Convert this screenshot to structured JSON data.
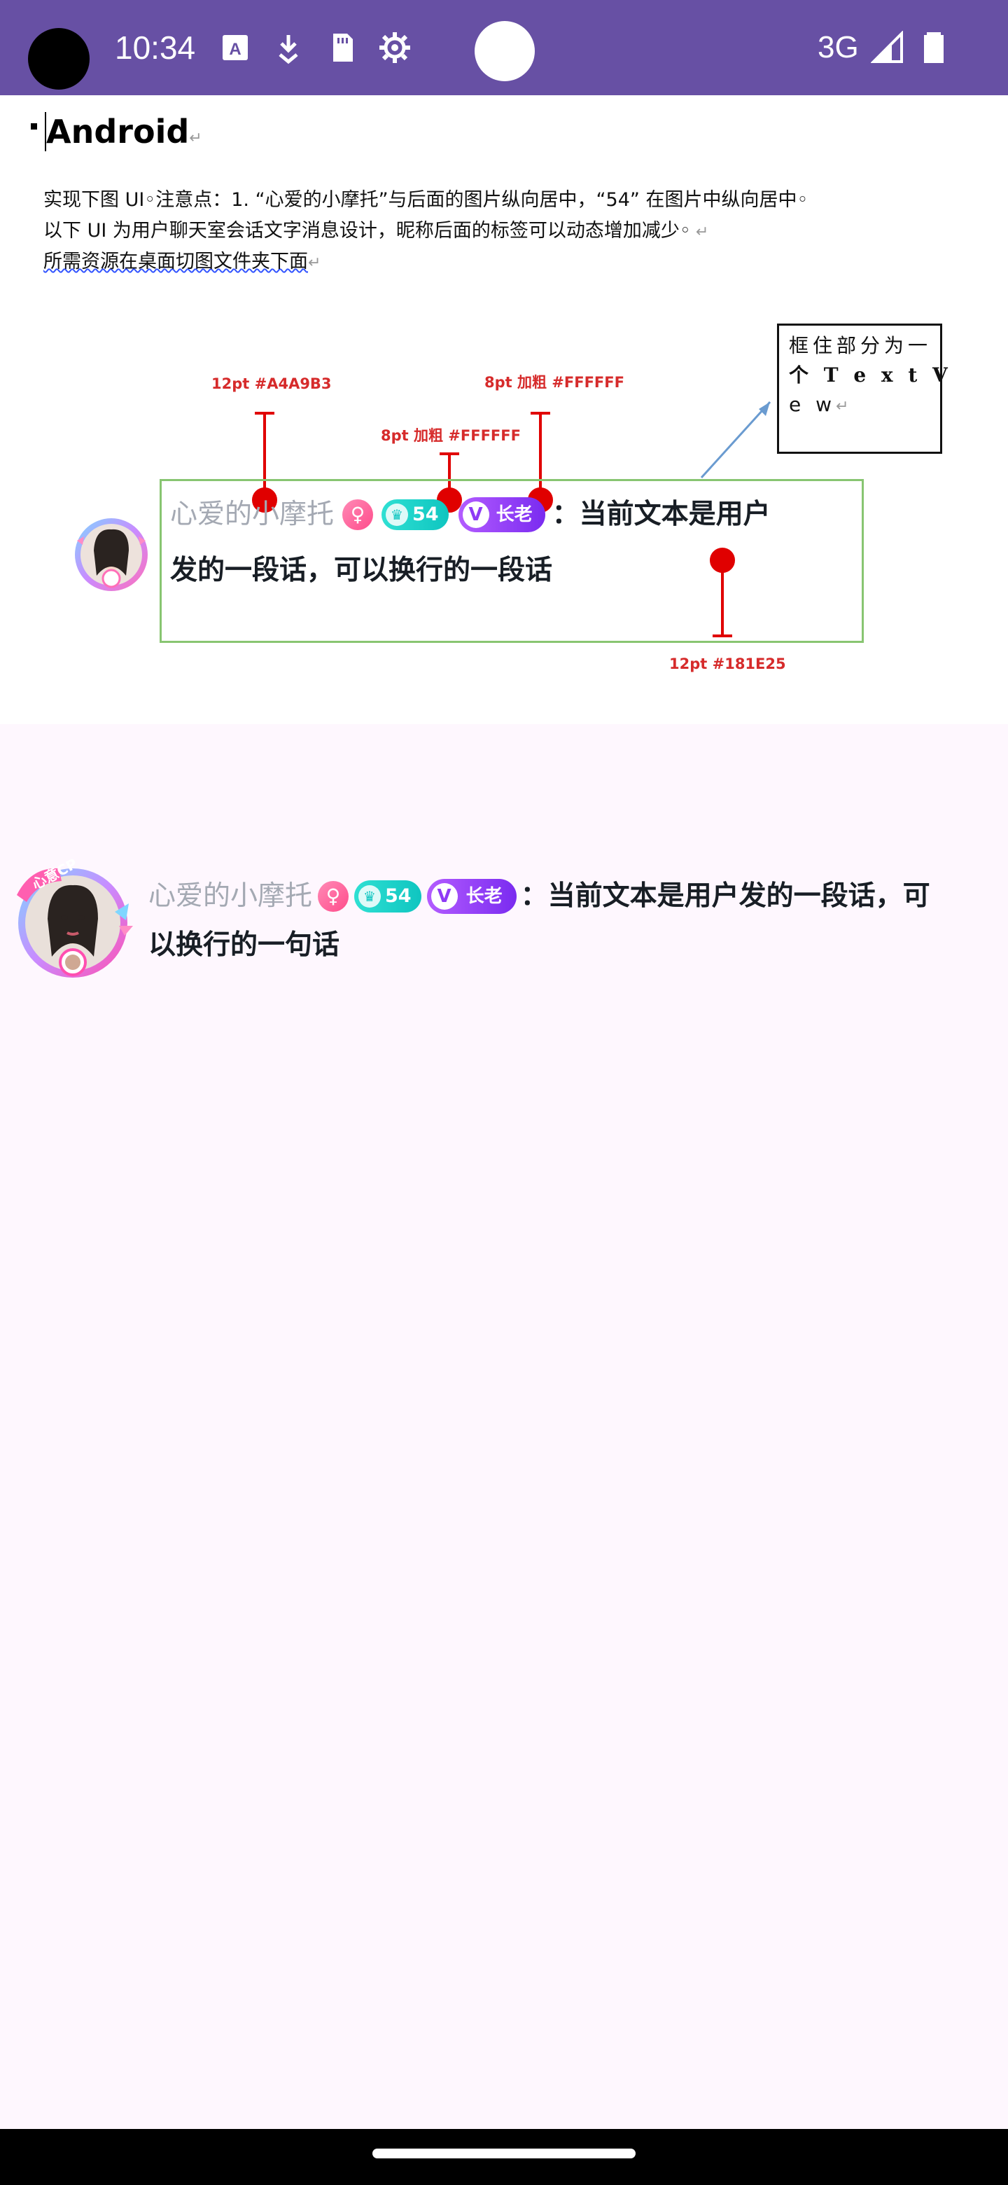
{
  "status_bar": {
    "time": "10:34",
    "network": "3G",
    "icons": [
      "font-a-icon",
      "download-icon",
      "sd-card-icon",
      "settings-gear-icon",
      "signal-icon",
      "battery-icon"
    ],
    "background_color": "#6750A4"
  },
  "document": {
    "title": "Android",
    "lines": [
      "实现下图 UI◦注意点：1. “心爱的小摩托”与后面的图片纵向居中，“54” 在图片中纵向居中◦",
      "以下 UI 为用户聊天室会话文字消息设计，昵称后面的标签可以动态增加减少◦",
      "所需资源在桌面切图文件夹下面"
    ],
    "annotation_box": [
      "框住部分为一",
      "个 T e x t V",
      "e w"
    ],
    "spec_labels": {
      "nickname": "12pt  #A4A9B3",
      "level_badge": "8pt 加粗  #FFFFFF",
      "role_badge": "8pt 加粗  #FFFFFF",
      "message": "12pt  #181E25"
    },
    "mockup": {
      "nickname": "心爱的小摩托",
      "level": "54",
      "role": "长老",
      "message_line1": "：当前文本是用户",
      "message_line2": "发的一段话，可以换行的一段话"
    }
  },
  "chat_message": {
    "nickname": "心爱的小摩托",
    "level": "54",
    "role": "长老",
    "message_line1": "：当前文本是用户发的一段话，可",
    "message_line2": "以换行的一句话",
    "avatar_caption": "心意CP"
  },
  "colors": {
    "nickname": "#A4A9B3",
    "message": "#181E25",
    "level_badge": "#1CCFC8",
    "role_badge": "#9146FA",
    "gender_badge": "#FF5C95",
    "app_background": "#FEF7FE",
    "annotation_red": "#E00000"
  }
}
